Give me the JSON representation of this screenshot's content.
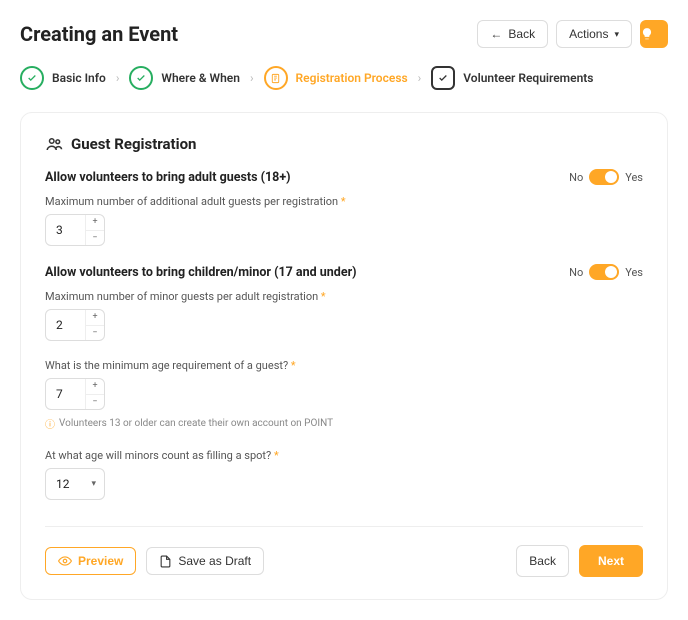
{
  "header": {
    "title": "Creating an Event",
    "back": "Back",
    "actions": "Actions"
  },
  "stepper": {
    "s1": "Basic Info",
    "s2": "Where & When",
    "s3": "Registration Process",
    "s4": "Volunteer Requirements"
  },
  "section": {
    "title": "Guest Registration"
  },
  "q1": {
    "label": "Allow volunteers to bring adult guests (18+)",
    "sublabel": "Maximum number of additional adult guests per registration",
    "value": "3"
  },
  "q2": {
    "label": "Allow volunteers to bring children/minor (17 and under)",
    "sublabel": "Maximum number of minor guests per adult registration",
    "value": "2"
  },
  "q3": {
    "label": "What is the minimum age requirement of a guest?",
    "value": "7",
    "hint": "Volunteers 13 or older can create their own account on POINT"
  },
  "q4": {
    "label": "At what age will minors count as filling a spot?",
    "value": "12"
  },
  "toggle": {
    "no": "No",
    "yes": "Yes"
  },
  "footer": {
    "preview": "Preview",
    "draft": "Save as Draft",
    "back": "Back",
    "next": "Next"
  }
}
